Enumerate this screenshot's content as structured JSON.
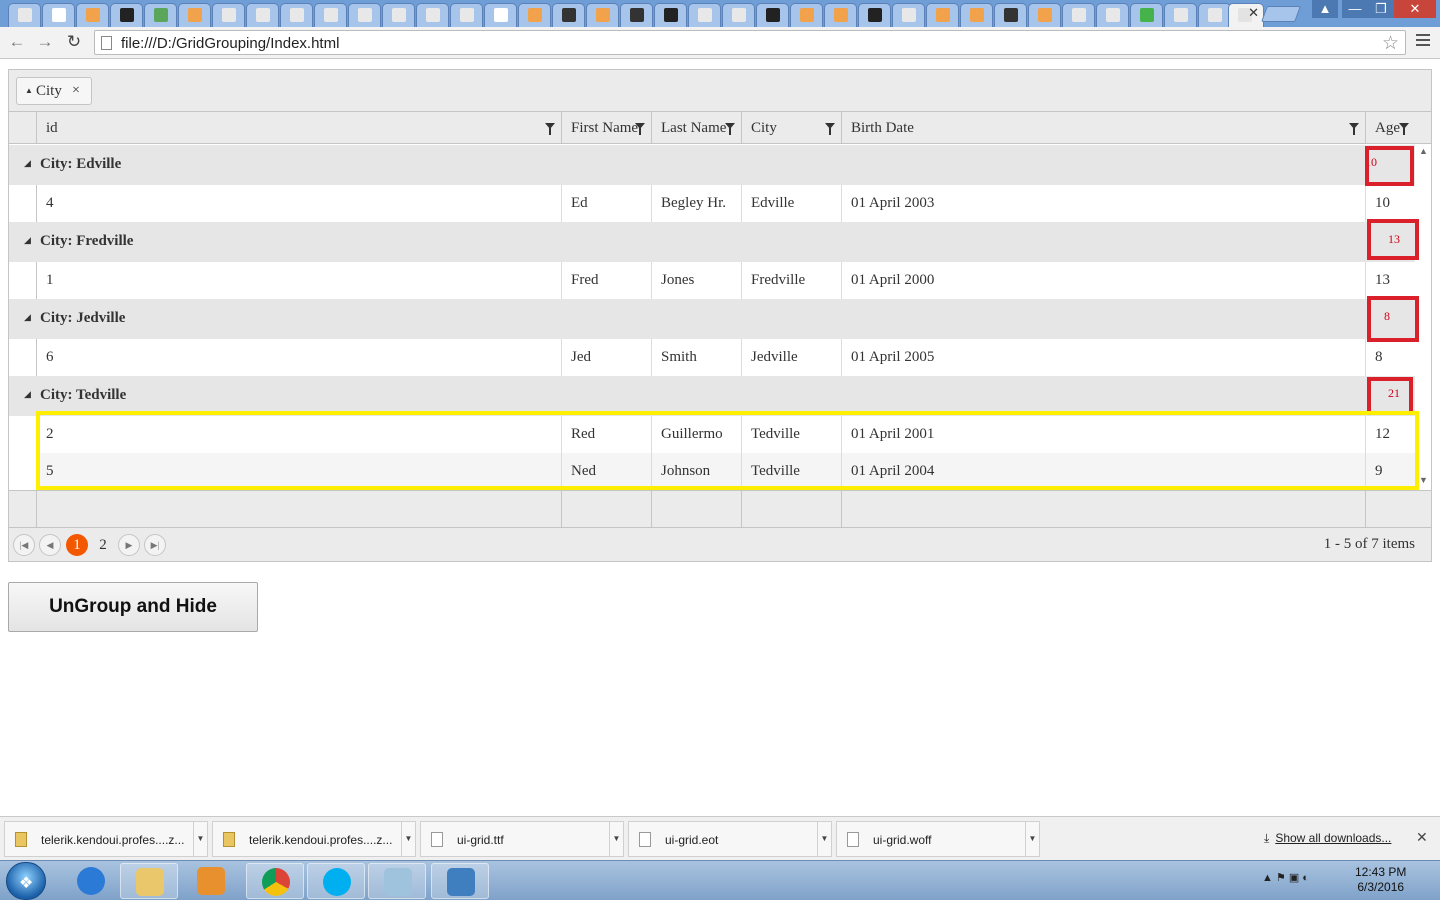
{
  "browser": {
    "url": "file:///D:/GridGrouping/Index.html",
    "tab_close": "✕",
    "window_controls": [
      "▲",
      "—",
      "❐",
      "✕"
    ]
  },
  "grid": {
    "group_indicator": {
      "label": "City",
      "remove": "×"
    },
    "columns": [
      "id",
      "First Name",
      "Last Name",
      "City",
      "Birth Date",
      "Age"
    ],
    "groups": [
      {
        "title": "City: Edville",
        "age_aggregate": "10",
        "rows": [
          {
            "id": "4",
            "first": "Ed",
            "last": "Begley Hr.",
            "city": "Edville",
            "birth": "01 April 2003",
            "age": "10"
          }
        ]
      },
      {
        "title": "City: Fredville",
        "age_aggregate": "13",
        "rows": [
          {
            "id": "1",
            "first": "Fred",
            "last": "Jones",
            "city": "Fredville",
            "birth": "01 April 2000",
            "age": "13"
          }
        ]
      },
      {
        "title": "City: Jedville",
        "age_aggregate": "8",
        "rows": [
          {
            "id": "6",
            "first": "Jed",
            "last": "Smith",
            "city": "Jedville",
            "birth": "01 April 2005",
            "age": "8"
          }
        ]
      },
      {
        "title": "City: Tedville",
        "age_aggregate": "21",
        "rows": [
          {
            "id": "2",
            "first": "Red",
            "last": "Guillermo",
            "city": "Tedville",
            "birth": "01 April 2001",
            "age": "12"
          },
          {
            "id": "5",
            "first": "Ned",
            "last": "Johnson",
            "city": "Tedville",
            "birth": "01 April 2004",
            "age": "9"
          }
        ]
      }
    ],
    "pager": {
      "pages": [
        "1",
        "2"
      ],
      "current": "1",
      "info": "1 - 5 of 7 items"
    }
  },
  "button": {
    "label": "UnGroup and Hide"
  },
  "downloads": {
    "items": [
      "telerik.kendoui.profes....z...",
      "telerik.kendoui.profes....z...",
      "ui-grid.ttf",
      "ui-grid.eot",
      "ui-grid.woff"
    ],
    "show_all": "Show all downloads...",
    "close": "✕"
  },
  "taskbar": {
    "time": "12:43 PM",
    "date": "6/3/2016"
  },
  "colors": {
    "annotation_red": "#d9202b",
    "annotation_yellow": "#ffee00",
    "pager_active": "#f35800"
  }
}
